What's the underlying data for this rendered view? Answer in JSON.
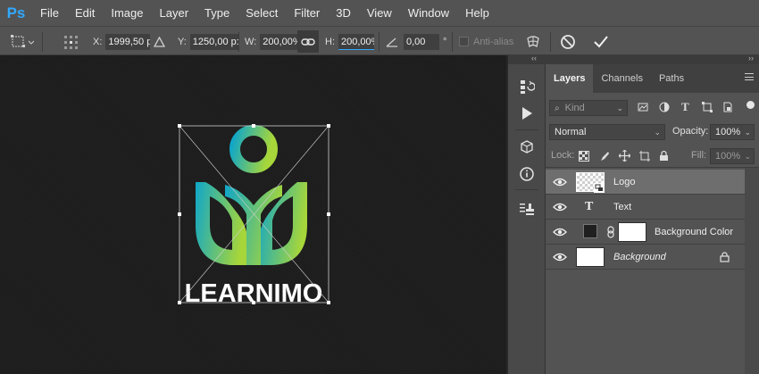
{
  "app": {
    "logo": "Ps"
  },
  "menu": [
    "File",
    "Edit",
    "Image",
    "Layer",
    "Type",
    "Select",
    "Filter",
    "3D",
    "View",
    "Window",
    "Help"
  ],
  "options": {
    "x_label": "X:",
    "x_value": "1999,50 p:",
    "y_label": "Y:",
    "y_value": "1250,00 p:",
    "w_label": "W:",
    "w_value": "200,00%",
    "h_label": "H:",
    "h_value": "200,00%",
    "angle_value": "0,00",
    "angle_unit": "°",
    "antialias_label": "Anti-alias"
  },
  "artwork": {
    "wordmark": "LEARNIMO",
    "gradient_start": "#0fa6c9",
    "gradient_end": "#a6d63a"
  },
  "panel": {
    "tabs": [
      "Layers",
      "Channels",
      "Paths"
    ],
    "kind_placeholder": "Kind",
    "blend_mode": "Normal",
    "opacity_label": "Opacity:",
    "opacity_value": "100%",
    "lock_label": "Lock:",
    "fill_label": "Fill:",
    "fill_value": "100%",
    "layers": [
      {
        "name": "Logo",
        "selected": true
      },
      {
        "name": "Text",
        "selected": false
      },
      {
        "name": "Background Color",
        "selected": false
      },
      {
        "name": "Background",
        "selected": false
      }
    ]
  },
  "colors": {
    "accent": "#31a8ff",
    "panel_bg": "#535353",
    "canvas_bg": "#1d1d1d"
  }
}
